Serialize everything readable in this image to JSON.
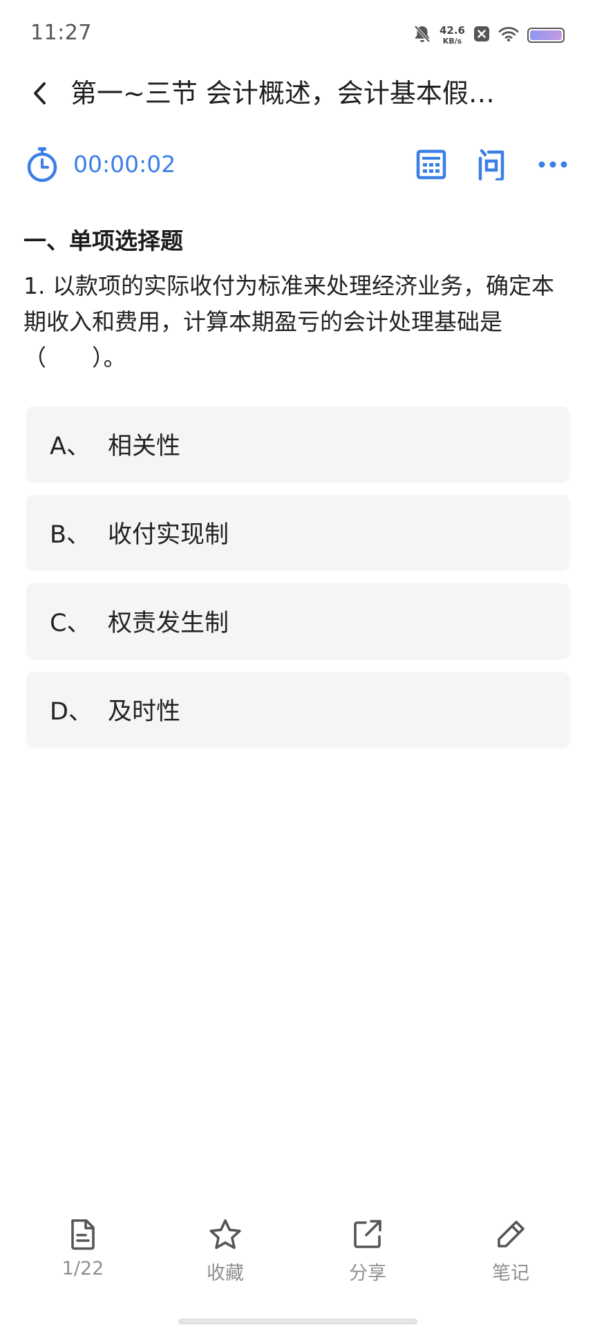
{
  "status_bar": {
    "time": "11:27",
    "net_speed": "42.6",
    "net_unit": "KB/s",
    "icons": [
      "mute-bell-icon",
      "close-notification-icon",
      "wifi-icon",
      "battery-icon"
    ]
  },
  "header": {
    "title": "第一~三节 会计概述，会计基本假…",
    "back_icon": "chevron-left-icon"
  },
  "toolbar": {
    "timer": "00:00:02",
    "accent_color": "#3b7ee6",
    "icons": [
      "stopwatch-icon",
      "calculator-icon",
      "ask-question-icon",
      "more-dots-icon"
    ]
  },
  "question": {
    "section_title": "一、单项选择题",
    "text": "1. 以款项的实际收付为标准来处理经济业务，确定本期收入和费用，计算本期盈亏的会计处理基础是（　　）。",
    "options": [
      {
        "letter": "A、",
        "text": "相关性"
      },
      {
        "letter": "B、",
        "text": "收付实现制"
      },
      {
        "letter": "C、",
        "text": "权责发生制"
      },
      {
        "letter": "D、",
        "text": "及时性"
      }
    ]
  },
  "bottom_nav": {
    "items": [
      {
        "label": "1/22",
        "icon": "document-icon"
      },
      {
        "label": "收藏",
        "icon": "star-icon"
      },
      {
        "label": "分享",
        "icon": "share-icon"
      },
      {
        "label": "笔记",
        "icon": "pencil-icon"
      }
    ]
  }
}
